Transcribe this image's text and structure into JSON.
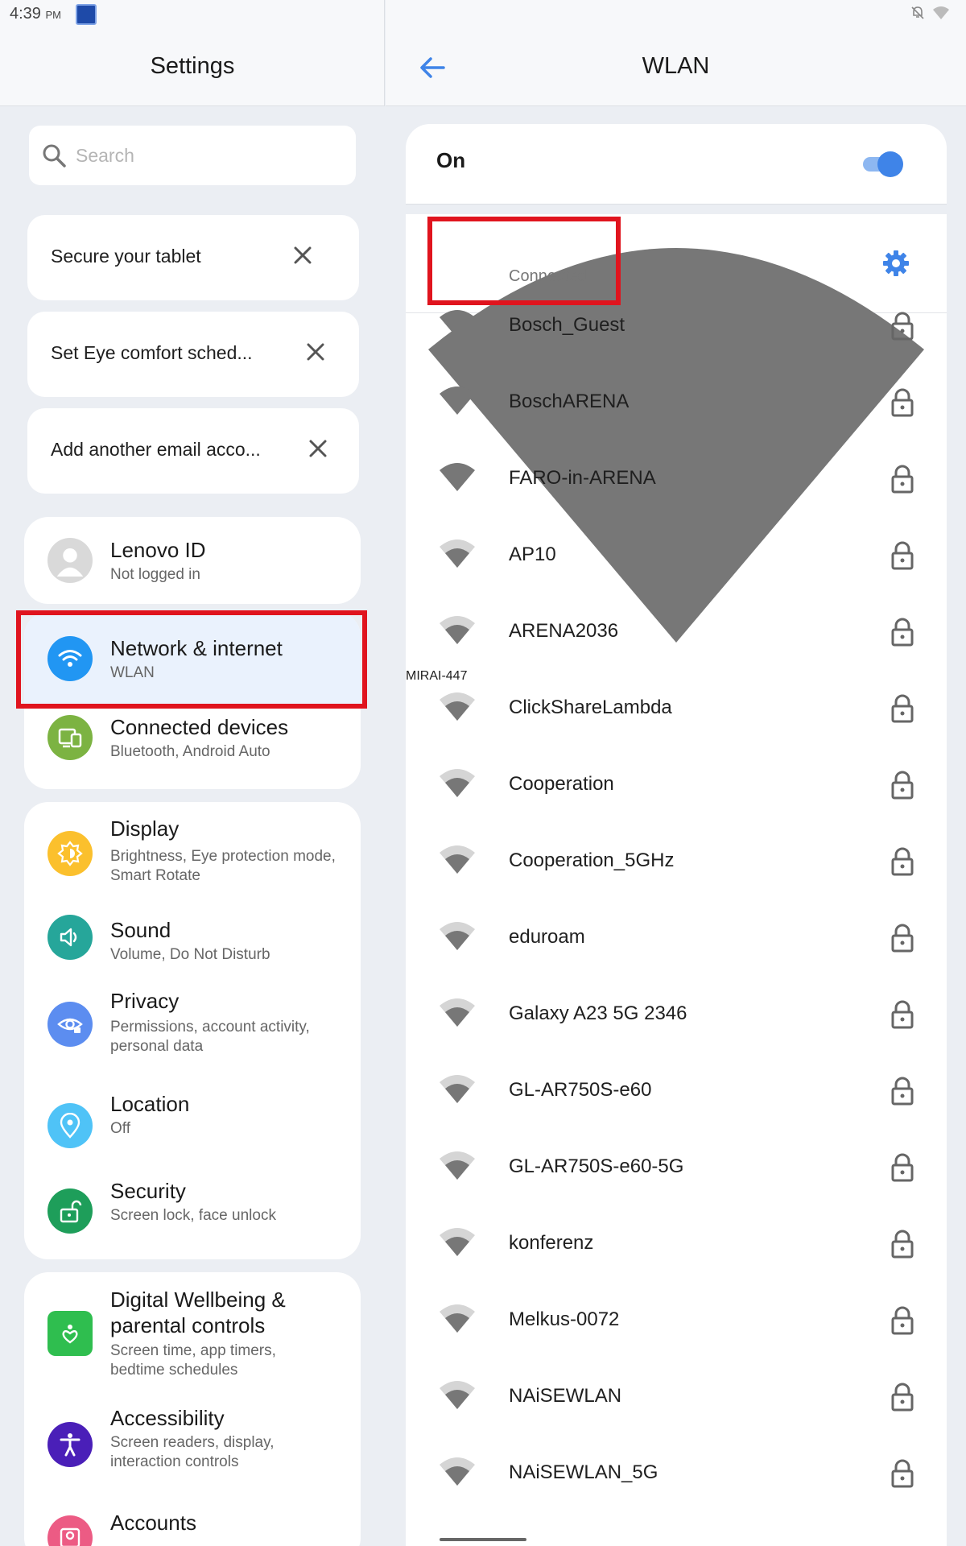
{
  "status": {
    "time": "4:39",
    "ampm": "PM"
  },
  "left": {
    "title": "Settings",
    "search_placeholder": "Search",
    "suggestions": [
      {
        "label": "Secure your tablet"
      },
      {
        "label": "Set Eye comfort sched..."
      },
      {
        "label": "Add another email acco..."
      }
    ],
    "lenovo": {
      "title": "Lenovo ID",
      "subtitle": "Not logged in"
    },
    "network": {
      "title": "Network & internet",
      "subtitle": "WLAN"
    },
    "connected": {
      "title": "Connected devices",
      "subtitle": "Bluetooth, Android Auto"
    },
    "display": {
      "title": "Display",
      "subtitle": "Brightness, Eye protection mode, Smart Rotate"
    },
    "sound": {
      "title": "Sound",
      "subtitle": "Volume, Do Not Disturb"
    },
    "privacy": {
      "title": "Privacy",
      "subtitle": "Permissions, account activity, personal data"
    },
    "location": {
      "title": "Location",
      "subtitle": "Off"
    },
    "security": {
      "title": "Security",
      "subtitle": "Screen lock, face unlock"
    },
    "wellbeing": {
      "title": "Digital Wellbeing & parental controls",
      "subtitle": "Screen time, app timers, bedtime schedules"
    },
    "accessibility": {
      "title": "Accessibility",
      "subtitle": "Screen readers, display, interaction controls"
    },
    "accounts": {
      "title": "Accounts"
    }
  },
  "right": {
    "title": "WLAN",
    "toggle_label": "On",
    "toggle_on": true,
    "connected_network": {
      "name": "MIRAI-447",
      "status": "Connected"
    },
    "networks": [
      {
        "name": "Bosch_Guest",
        "signal": "strong"
      },
      {
        "name": "BoschARENA",
        "signal": "strong"
      },
      {
        "name": "FARO-in-ARENA",
        "signal": "strong"
      },
      {
        "name": "AP10",
        "signal": "weak"
      },
      {
        "name": "ARENA2036",
        "signal": "weak"
      },
      {
        "name": "ClickShareLambda",
        "signal": "weak"
      },
      {
        "name": "Cooperation",
        "signal": "weak"
      },
      {
        "name": "Cooperation_5GHz",
        "signal": "weak"
      },
      {
        "name": "eduroam",
        "signal": "weak"
      },
      {
        "name": "Galaxy A23 5G 2346",
        "signal": "weak"
      },
      {
        "name": "GL-AR750S-e60",
        "signal": "weak"
      },
      {
        "name": "GL-AR750S-e60-5G",
        "signal": "weak"
      },
      {
        "name": "konferenz",
        "signal": "weak"
      },
      {
        "name": "Melkus-0072",
        "signal": "weak"
      },
      {
        "name": "NAiSEWLAN",
        "signal": "weak"
      },
      {
        "name": "NAiSEWLAN_5G",
        "signal": "weak"
      }
    ]
  },
  "colors": {
    "accent": "#3f84e8",
    "highlight": "#e0141e",
    "network_icon": "#2196f3",
    "connected_icon": "#7cb342",
    "display_icon": "#fbc02d",
    "sound_icon": "#26a69a",
    "privacy_icon": "#5c8df0",
    "location_icon": "#4fc3f7",
    "security_icon": "#1e9e5a",
    "wellbeing_icon": "#2fbe4f",
    "accessibility_icon": "#4a1fb8",
    "accounts_icon": "#ec5b84"
  }
}
